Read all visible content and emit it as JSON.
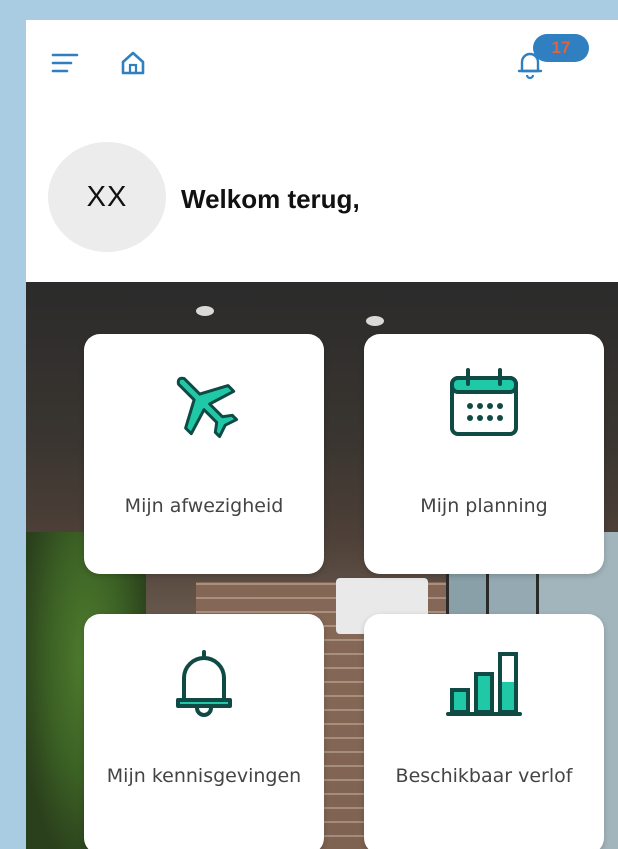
{
  "header": {
    "menu_icon": "menu-icon",
    "home_icon": "home-icon",
    "notifications_icon": "bell-icon",
    "notification_count": "17"
  },
  "profile": {
    "initials": "XX",
    "welcome_text": "Welkom terug,"
  },
  "tiles": [
    {
      "label": "Mijn afwezigheid",
      "icon": "airplane-icon"
    },
    {
      "label": "Mijn planning",
      "icon": "calendar-icon"
    },
    {
      "label": "Mijn kennisgevingen",
      "icon": "bell-icon"
    },
    {
      "label": "Beschikbaar verlof",
      "icon": "bar-chart-icon"
    }
  ],
  "colors": {
    "accent_blue": "#2f7fc1",
    "icon_teal": "#1fc9a8",
    "icon_dark": "#0f4a44",
    "badge_text": "#e8603a",
    "page_background": "#a9cce3"
  }
}
